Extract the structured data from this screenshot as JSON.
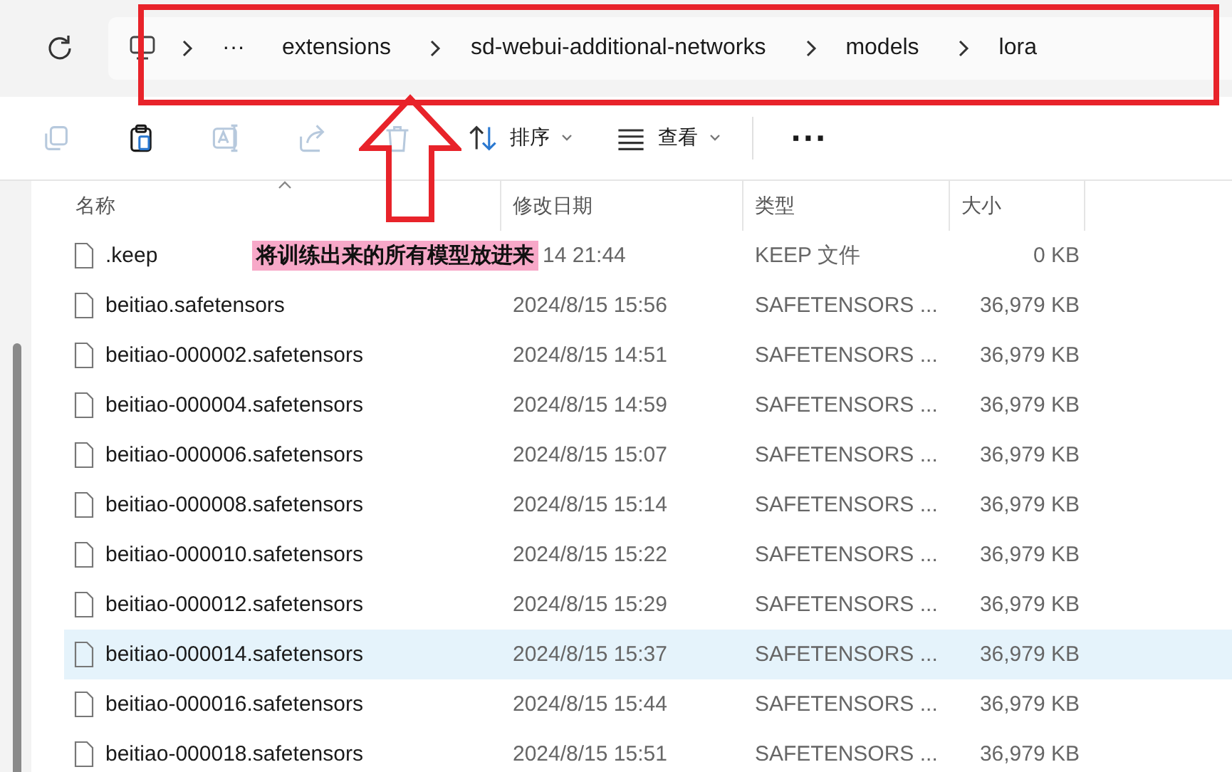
{
  "breadcrumb": {
    "overflow": "···",
    "segments": [
      "extensions",
      "sd-webui-additional-networks",
      "models",
      "lora"
    ]
  },
  "toolbar": [
    {
      "kind": "copy",
      "disabled": true
    },
    {
      "kind": "paste",
      "disabled": false
    },
    {
      "kind": "rename",
      "disabled": true
    },
    {
      "kind": "share",
      "disabled": true
    },
    {
      "kind": "delete",
      "disabled": true
    },
    {
      "kind": "sort",
      "label": "排序",
      "disabled": false
    },
    {
      "kind": "view",
      "label": "查看",
      "disabled": false
    },
    {
      "kind": "more",
      "label": "···",
      "disabled": false
    }
  ],
  "table": {
    "columns": [
      "名称",
      "修改日期",
      "类型",
      "大小"
    ],
    "rows": [
      {
        "name": ".keep",
        "date": "14 21:44",
        "type": "KEEP 文件",
        "size": "0 KB",
        "selected": false,
        "note": "将训练出来的所有模型放进来"
      },
      {
        "name": "beitiao.safetensors",
        "date": "2024/8/15 15:56",
        "type": "SAFETENSORS ...",
        "size": "36,979 KB",
        "selected": false
      },
      {
        "name": "beitiao-000002.safetensors",
        "date": "2024/8/15 14:51",
        "type": "SAFETENSORS ...",
        "size": "36,979 KB",
        "selected": false
      },
      {
        "name": "beitiao-000004.safetensors",
        "date": "2024/8/15 14:59",
        "type": "SAFETENSORS ...",
        "size": "36,979 KB",
        "selected": false
      },
      {
        "name": "beitiao-000006.safetensors",
        "date": "2024/8/15 15:07",
        "type": "SAFETENSORS ...",
        "size": "36,979 KB",
        "selected": false
      },
      {
        "name": "beitiao-000008.safetensors",
        "date": "2024/8/15 15:14",
        "type": "SAFETENSORS ...",
        "size": "36,979 KB",
        "selected": false
      },
      {
        "name": "beitiao-000010.safetensors",
        "date": "2024/8/15 15:22",
        "type": "SAFETENSORS ...",
        "size": "36,979 KB",
        "selected": false
      },
      {
        "name": "beitiao-000012.safetensors",
        "date": "2024/8/15 15:29",
        "type": "SAFETENSORS ...",
        "size": "36,979 KB",
        "selected": false
      },
      {
        "name": "beitiao-000014.safetensors",
        "date": "2024/8/15 15:37",
        "type": "SAFETENSORS ...",
        "size": "36,979 KB",
        "selected": true
      },
      {
        "name": "beitiao-000016.safetensors",
        "date": "2024/8/15 15:44",
        "type": "SAFETENSORS ...",
        "size": "36,979 KB",
        "selected": false
      },
      {
        "name": "beitiao-000018.safetensors",
        "date": "2024/8/15 15:51",
        "type": "SAFETENSORS ...",
        "size": "36,979 KB",
        "selected": false
      }
    ]
  }
}
